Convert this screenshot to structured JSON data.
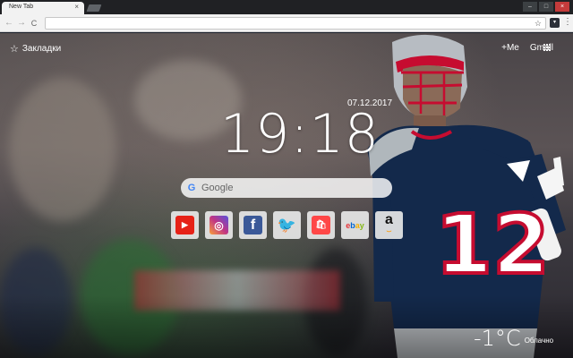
{
  "browser": {
    "tab_title": "New Tab",
    "tab_close": "×",
    "address_value": "",
    "nav": {
      "back": "←",
      "forward": "→",
      "reload": "C"
    },
    "star": "☆",
    "menu": "⋮",
    "window": {
      "minimize": "–",
      "maximize": "□",
      "close": "×"
    }
  },
  "page": {
    "bookmarks_label": "Закладки",
    "top_links": [
      "+Me",
      "Gmail"
    ],
    "date": "07.12.2017",
    "time": "19:18",
    "search_placeholder": "Google",
    "shortcuts": [
      {
        "name": "youtube",
        "glyph": "▶",
        "color": "#e62117"
      },
      {
        "name": "instagram",
        "glyph": "◎",
        "color": "#c13584"
      },
      {
        "name": "facebook",
        "glyph": "f",
        "color": "#3b5998"
      },
      {
        "name": "twitter",
        "glyph": "🐦",
        "color": "#1da1f2"
      },
      {
        "name": "aliexpress",
        "glyph": "🛍",
        "color": "#ff4747"
      },
      {
        "name": "ebay",
        "glyph": "ebay",
        "color": "#e53238"
      },
      {
        "name": "amazon",
        "glyph": "a",
        "color": "#111111"
      }
    ],
    "weather": {
      "temperature": "-1°C",
      "condition": "Облачно"
    },
    "jersey_number": "12"
  },
  "colors": {
    "patriots_navy": "#13294b",
    "patriots_red": "#c60c30",
    "patriots_silver": "#b0b7bc"
  }
}
